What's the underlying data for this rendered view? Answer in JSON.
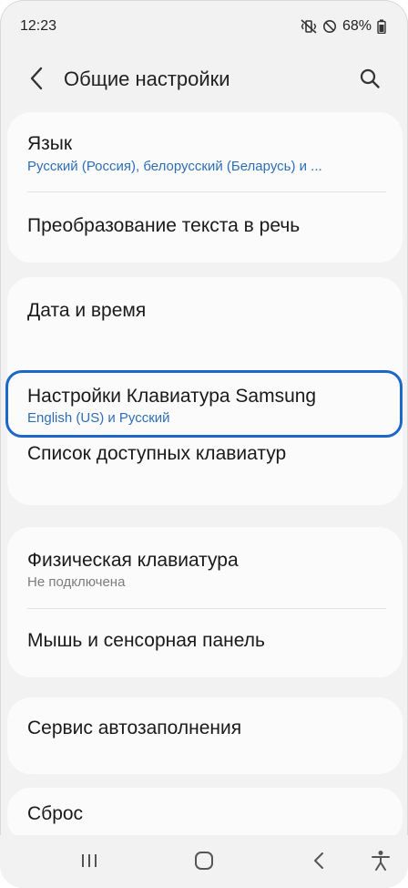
{
  "status_bar": {
    "time": "12:23",
    "battery": "68%"
  },
  "header": {
    "title": "Общие настройки",
    "back_icon": "chevron-left-icon",
    "search_icon": "search-icon"
  },
  "settings": {
    "language": {
      "title": "Язык",
      "subtitle": "Русский (Россия), белорусский (Беларусь) и ..."
    },
    "tts": {
      "title": "Преобразование текста в речь"
    },
    "date_time": {
      "title": "Дата и время"
    },
    "samsung_keyboard": {
      "title": "Настройки Клавиатура Samsung",
      "subtitle": "English (US) и Русский"
    },
    "keyboard_list": {
      "title": "Список доступных клавиатур"
    },
    "physical_keyboard": {
      "title": "Физическая клавиатура",
      "subtitle": "Не подключена"
    },
    "mouse_touchpad": {
      "title": "Мышь и сенсорная панель"
    },
    "autofill": {
      "title": "Сервис автозаполнения"
    },
    "reset": {
      "title": "Сброс"
    }
  },
  "colors": {
    "accent_subtitle": "#2d6fb6",
    "focus_ring": "#1d66cc",
    "background": "#f2f2f2"
  }
}
